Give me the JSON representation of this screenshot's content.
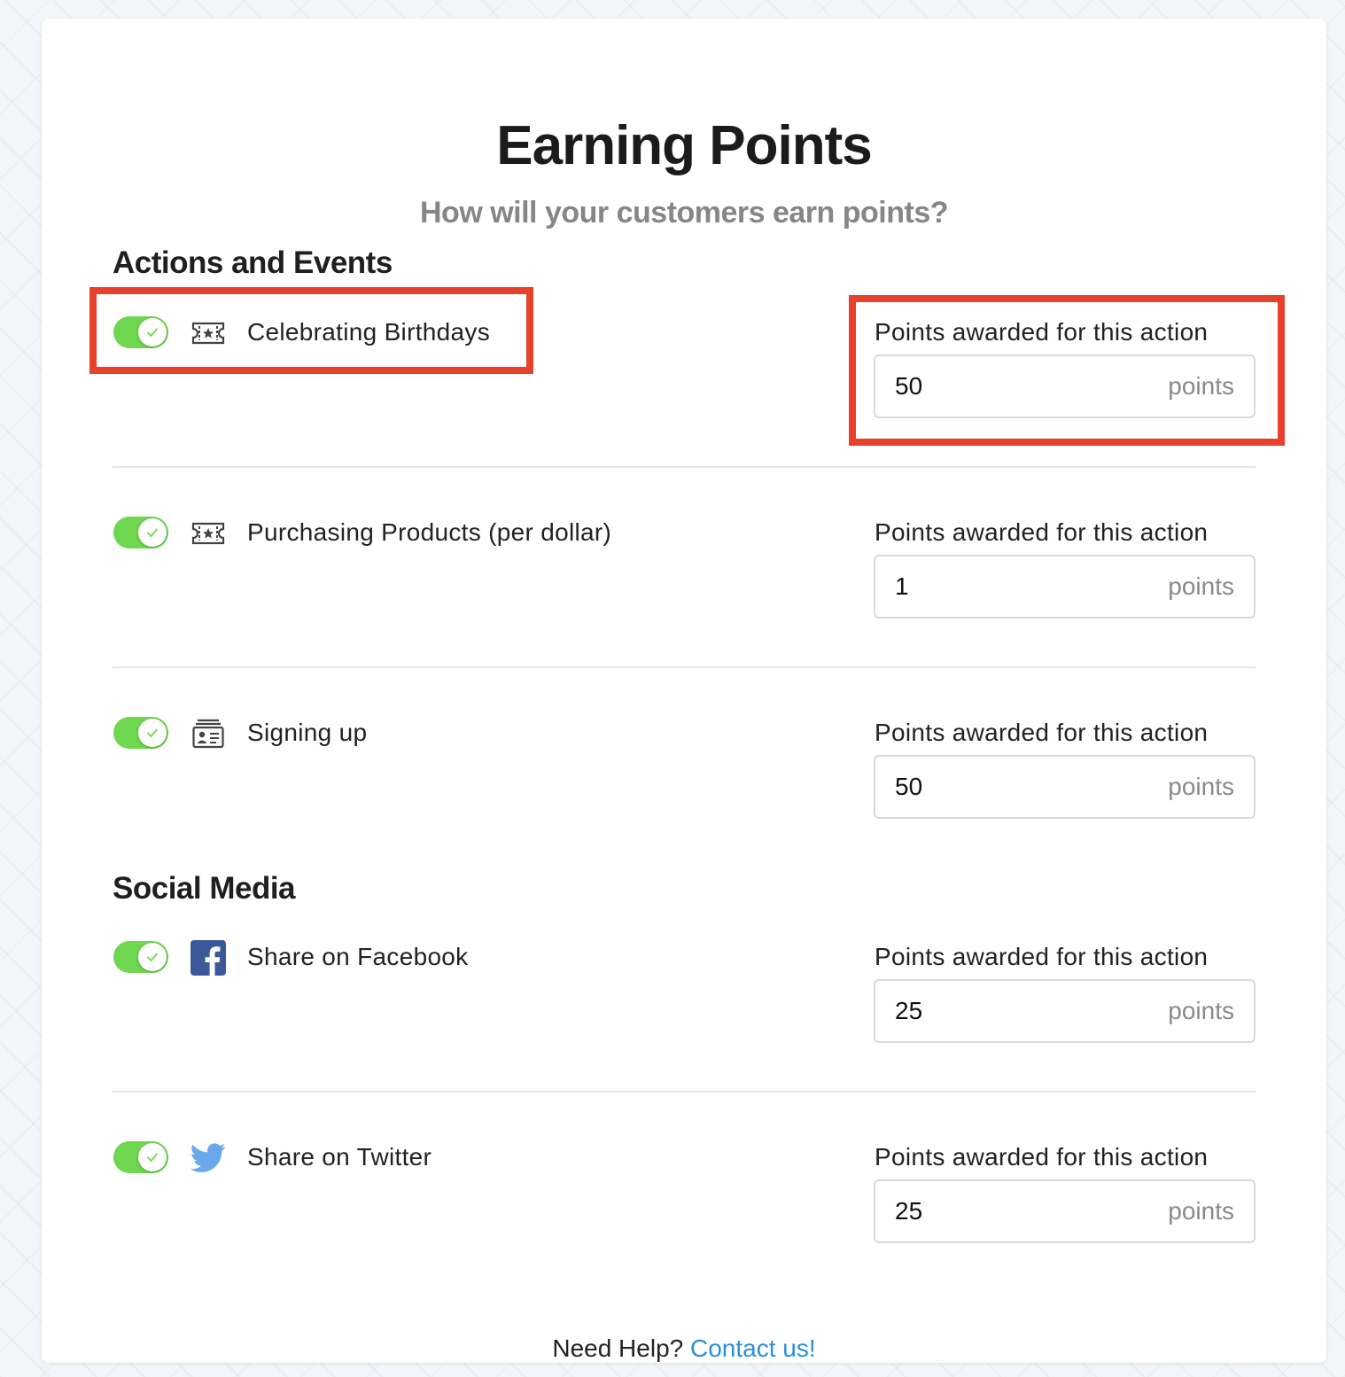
{
  "page": {
    "title": "Earning Points",
    "subtitle": "How will your customers earn points?"
  },
  "sections": [
    {
      "heading": "Actions and Events",
      "items": [
        {
          "label": "Celebrating Birthdays",
          "icon": "ticket-icon",
          "enabled": true,
          "points_label": "Points awarded for this action",
          "points_value": "50",
          "points_suffix": "points"
        },
        {
          "label": "Purchasing Products (per dollar)",
          "icon": "ticket-icon",
          "enabled": true,
          "points_label": "Points awarded for this action",
          "points_value": "1",
          "points_suffix": "points"
        },
        {
          "label": "Signing up",
          "icon": "id-card-icon",
          "enabled": true,
          "points_label": "Points awarded for this action",
          "points_value": "50",
          "points_suffix": "points"
        }
      ]
    },
    {
      "heading": "Social Media",
      "items": [
        {
          "label": "Share on Facebook",
          "icon": "facebook-icon",
          "enabled": true,
          "points_label": "Points awarded for this action",
          "points_value": "25",
          "points_suffix": "points"
        },
        {
          "label": "Share on Twitter",
          "icon": "twitter-icon",
          "enabled": true,
          "points_label": "Points awarded for this action",
          "points_value": "25",
          "points_suffix": "points"
        }
      ]
    }
  ],
  "footer": {
    "prefix": "Need Help?",
    "link_text": "Contact us!"
  },
  "colors": {
    "toggle_on": "#6fd64f",
    "highlight": "#e8412b",
    "link": "#2b8fd9",
    "facebook": "#3b5998",
    "twitter": "#6aa8ec"
  }
}
